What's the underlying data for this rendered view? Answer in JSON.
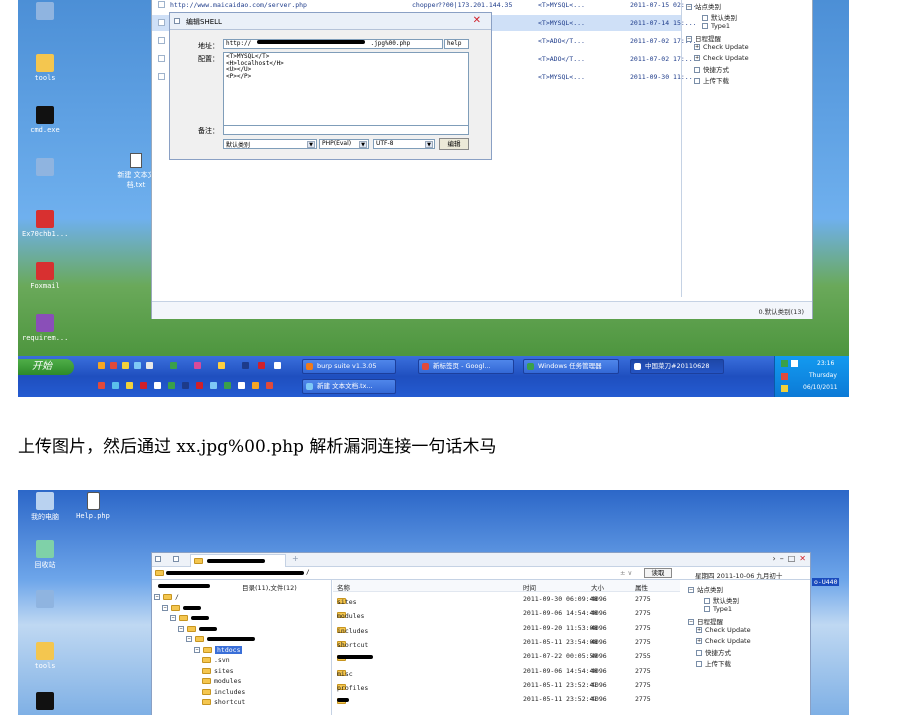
{
  "screenshot1": {
    "desktop_icons": [
      {
        "label": "",
        "icon": "system-icon"
      },
      {
        "label": "tools",
        "icon": "folder-icon"
      },
      {
        "label": "cmd.exe",
        "icon": "cmd-icon"
      },
      {
        "label": "",
        "icon": "network-icon"
      },
      {
        "label": "Ex70chb1...",
        "icon": "app-icon"
      },
      {
        "label": "Foxmail",
        "icon": "foxmail-icon"
      },
      {
        "label": "requirem...",
        "icon": "rar-icon"
      }
    ],
    "desktop_file": {
      "label": "新建 文本文档.txt",
      "icon": "text-file-icon"
    },
    "list_rows": [
      {
        "url": "http://www.maicaidao.com/server.php",
        "name": "chopper",
        "ip": "??00|173.201.144.35",
        "db": "<T>MYSQL<...",
        "time": "2011-07-15 02:..."
      },
      {
        "url": "",
        "name": "",
        "ip": "",
        "db": "<T>MYSQL<...",
        "time": "2011-07-14 15:..."
      },
      {
        "url": "",
        "name": "",
        "ip": "",
        "db": "<T>ADO</T...",
        "time": "2011-07-02 17:..."
      },
      {
        "url": "",
        "name": "",
        "ip": "",
        "db": "<T>ADO</T...",
        "time": "2011-07-02 17:..."
      },
      {
        "url": "",
        "name": "",
        "ip": "",
        "db": "<T>MYSQL<...",
        "time": "2011-09-30 11:..."
      }
    ],
    "tree": [
      {
        "label": "站点类别",
        "indent": 0,
        "box": "minus"
      },
      {
        "label": "默认类别",
        "indent": 2,
        "box": "none"
      },
      {
        "label": "Type1",
        "indent": 2,
        "box": "none"
      },
      {
        "label": "日程提醒",
        "indent": 0,
        "box": "minus"
      },
      {
        "label": "Check Update",
        "indent": 1,
        "box": "plus"
      },
      {
        "label": "Check Update",
        "indent": 1,
        "box": "plus"
      },
      {
        "label": "快捷方式",
        "indent": 1,
        "box": "none"
      },
      {
        "label": "上传下载",
        "indent": 1,
        "box": "none"
      }
    ],
    "status_text": "0.默认类别(13)",
    "dialog": {
      "title": "编辑SHELL",
      "address_label": "地址：",
      "address_prefix": "http://",
      "address_suffix": ".jpg%00.php",
      "help_label": "help",
      "config_label": "配置：",
      "config_lines": [
        "<T>MYSQL</T>",
        "<H>localhost</H>",
        "<U></U>",
        "<P></P>"
      ],
      "note_label": "备注：",
      "category_value": "默认类别",
      "type_value": "PHP(Eval)",
      "encoding_value": "UTF-8",
      "edit_button": "编辑"
    },
    "taskbar": {
      "start_label": "开始",
      "tasks_row1": [
        {
          "label": "burp suite v1.3.05",
          "icon": "burp-icon"
        },
        {
          "label": "新标签页 - Googl...",
          "icon": "chrome-icon"
        },
        {
          "label": "Windows 任务管理器",
          "icon": "taskmgr-icon"
        },
        {
          "label": "中国菜刀#20110628",
          "icon": "chopper-icon"
        }
      ],
      "tasks_row2": [
        {
          "label": "新建 文本文档.tx...",
          "icon": "notepad-icon"
        }
      ],
      "clock_time": "23:16",
      "clock_day": "Thursday",
      "clock_date": "06/10/2011"
    }
  },
  "caption": "上传图片，然后通过 xx.jpg%00.php 解析漏洞连接一句话木马",
  "screenshot2": {
    "desktop_icons": [
      {
        "label": "我的电脑",
        "icon": "my-computer-icon"
      },
      {
        "label": "Help.php",
        "icon": "php-file-icon"
      },
      {
        "label": "回收站",
        "icon": "recycle-bin-icon"
      },
      {
        "label": "",
        "icon": "network-icon"
      },
      {
        "label": "tools",
        "icon": "folder-icon"
      },
      {
        "label": "",
        "icon": "cmd-icon"
      }
    ],
    "new_tab_label": "+",
    "window_controls": [
      "›",
      "–",
      "□",
      "✕"
    ],
    "path_root": "/",
    "dropdown_glyph": "± ∨",
    "read_button": "读取",
    "date_text": "星期四 2011-10-06 九月初十",
    "side_tag": "o-U440",
    "header_left": "目录(11),文件(12)",
    "columns": {
      "name": "名称",
      "time": "时间",
      "size": "大小",
      "attr": "属性"
    },
    "dir_tree": [
      {
        "label": "/",
        "indent": 0
      },
      {
        "label": "",
        "indent": 1
      },
      {
        "label": "",
        "indent": 2
      },
      {
        "label": "",
        "indent": 3
      },
      {
        "label": "",
        "indent": 4
      },
      {
        "label": "htdocs",
        "indent": 5,
        "selected": true
      },
      {
        "label": ".svn",
        "indent": 6
      },
      {
        "label": "sites",
        "indent": 6
      },
      {
        "label": "modules",
        "indent": 6
      },
      {
        "label": "includes",
        "indent": 6
      },
      {
        "label": "shortcut",
        "indent": 6
      }
    ],
    "files": [
      {
        "name": "sites",
        "time": "2011-09-30 06:09:48",
        "size": "4096",
        "attr": "2775"
      },
      {
        "name": "modules",
        "time": "2011-09-06 14:54:40",
        "size": "4096",
        "attr": "2775"
      },
      {
        "name": "includes",
        "time": "2011-09-20 11:53:08",
        "size": "4096",
        "attr": "2775"
      },
      {
        "name": "shortcut",
        "time": "2011-05-11 23:54:08",
        "size": "4096",
        "attr": "2775"
      },
      {
        "name": "",
        "time": "2011-07-22 00:05:59",
        "size": "4096",
        "attr": "2755"
      },
      {
        "name": "misc",
        "time": "2011-09-06 14:54:40",
        "size": "4096",
        "attr": "2775"
      },
      {
        "name": "profiles",
        "time": "2011-05-11 23:52:41",
        "size": "4096",
        "attr": "2775"
      },
      {
        "name": "",
        "time": "2011-05-11 23:52:41",
        "size": "4096",
        "attr": "2775"
      }
    ],
    "tree": [
      {
        "label": "站点类别",
        "indent": 0,
        "box": "minus"
      },
      {
        "label": "默认类别",
        "indent": 2,
        "box": "none"
      },
      {
        "label": "Type1",
        "indent": 2,
        "box": "none"
      },
      {
        "label": "日程提醒",
        "indent": 0,
        "box": "minus"
      },
      {
        "label": "Check Update",
        "indent": 1,
        "box": "plus"
      },
      {
        "label": "Check Update",
        "indent": 1,
        "box": "plus"
      },
      {
        "label": "快捷方式",
        "indent": 1,
        "box": "none"
      },
      {
        "label": "上传下载",
        "indent": 1,
        "box": "none"
      }
    ]
  }
}
